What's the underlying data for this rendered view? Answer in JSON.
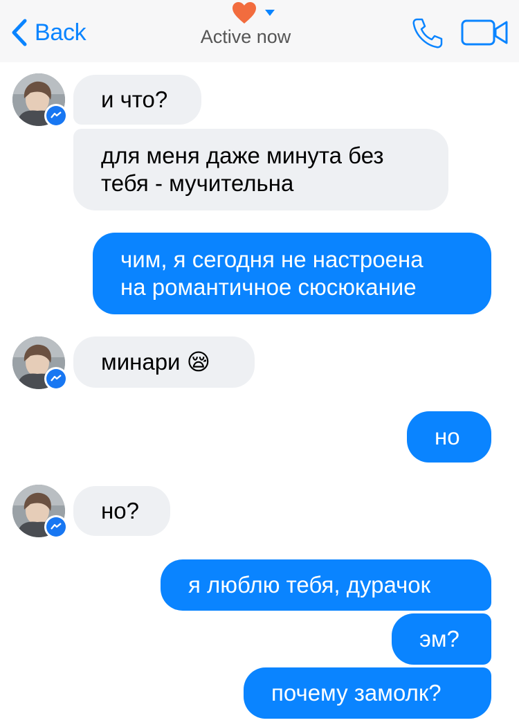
{
  "header": {
    "back_label": "Back",
    "status": "Active now",
    "back_icon": "chevron-left-icon",
    "heart_icon": "heart-icon",
    "call_icon": "phone-icon",
    "video_icon": "video-camera-icon",
    "accent_color": "#0a84ff",
    "heart_color": "#f26c3e"
  },
  "messages": [
    {
      "from": "them",
      "text": "и что?"
    },
    {
      "from": "them",
      "text": "для меня даже минута без\nтебя - мучительна"
    },
    {
      "from": "me",
      "text": "чим, я сегодня не настроена\nна романтичное сюсюкание"
    },
    {
      "from": "them",
      "text": "минари 😪"
    },
    {
      "from": "me",
      "text": "но"
    },
    {
      "from": "them",
      "text": "но?"
    },
    {
      "from": "me",
      "text": "я люблю тебя, дурачок"
    },
    {
      "from": "me",
      "text": "эм?"
    },
    {
      "from": "me",
      "text": "почему замолк?"
    }
  ],
  "colors": {
    "incoming_bubble": "#eef0f3",
    "outgoing_bubble": "#0a84ff",
    "header_bg": "#f7f7f8"
  }
}
